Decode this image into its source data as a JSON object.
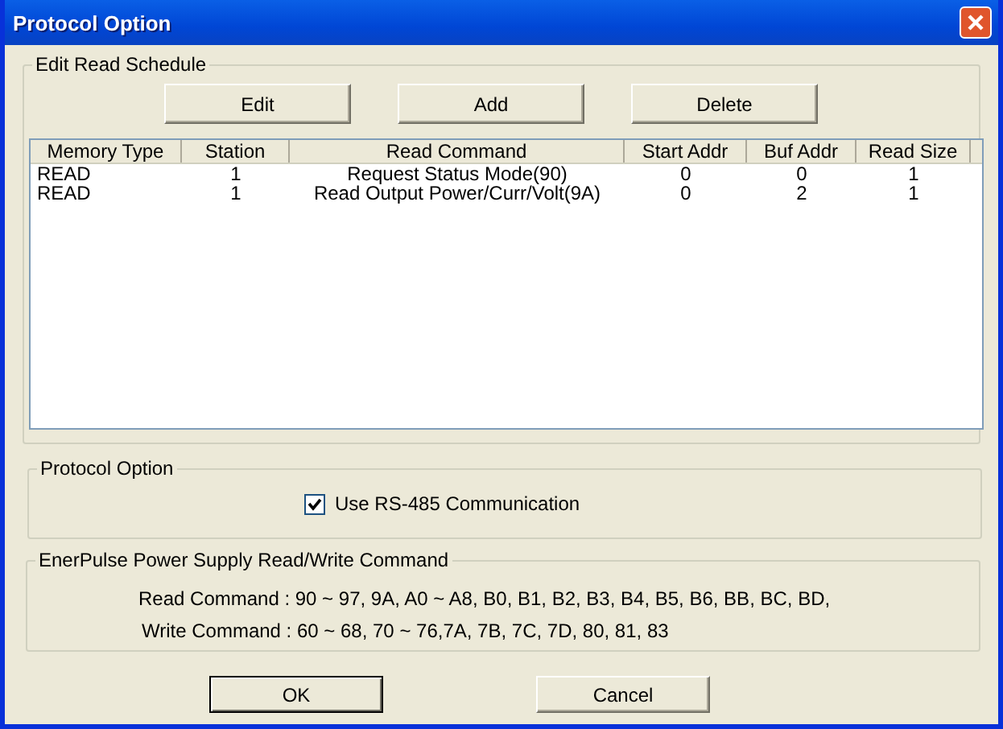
{
  "window": {
    "title": "Protocol Option"
  },
  "schedule": {
    "title": "Edit Read Schedule",
    "buttons": [
      "Edit",
      "Add",
      "Delete"
    ],
    "columns": [
      "Memory Type",
      "Station",
      "Read Command",
      "Start Addr",
      "Buf Addr",
      "Read Size"
    ],
    "rows": [
      [
        "READ",
        "1",
        "Request Status Mode(90)",
        "0",
        "0",
        "1"
      ],
      [
        "READ",
        "1",
        "Read Output Power/Curr/Volt(9A)",
        "0",
        "2",
        "1"
      ]
    ]
  },
  "protocol": {
    "title": "Protocol Option",
    "checkbox": {
      "label": "Use RS-485 Communication",
      "checked": true
    }
  },
  "commands": {
    "title": "EnerPulse Power Supply Read/Write Command",
    "lines": [
      "Read Command : 90 ~ 97, 9A, A0 ~ A8, B0, B1, B2, B3, B4, B5, B6, BB, BC, BD,",
      "Write Command : 60 ~ 68, 70 ~ 76,7A, 7B, 7C, 7D, 80, 81, 83"
    ]
  },
  "buttons": [
    {
      "label": "OK",
      "default": true
    },
    {
      "label": "Cancel",
      "default": false
    }
  ]
}
